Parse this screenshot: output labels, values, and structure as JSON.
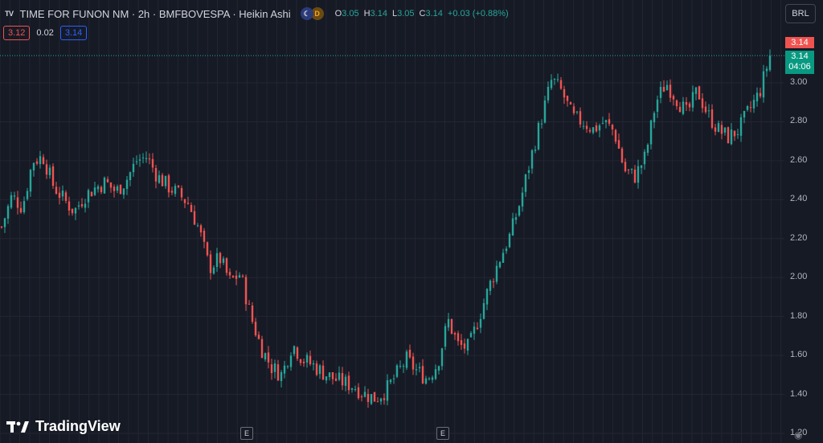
{
  "header": {
    "logo_glyph": "TV",
    "symbol_line": "TIME FOR FUNON NM · 2h · BMFBOVESPA · Heikin Ashi",
    "badge_d": "D",
    "ohlc": {
      "o_key": "O",
      "o_val": "3.05",
      "h_key": "H",
      "h_val": "3.14",
      "l_key": "L",
      "l_val": "3.05",
      "c_key": "C",
      "c_val": "3.14",
      "change": "+0.03 (+0.88%)"
    },
    "bid": "3.12",
    "spread": "0.02",
    "ask": "3.14"
  },
  "currency": "BRL",
  "price_tags": {
    "red": "3.14",
    "green": "3.14",
    "countdown": "04:06"
  },
  "brand": {
    "name": "TradingView"
  },
  "events": [
    "E",
    "E"
  ],
  "colors": {
    "background": "#161a25",
    "up": "#26a69a",
    "down": "#ef5350",
    "grid": "#232632",
    "price_line": "#26a69a"
  },
  "chart_data": {
    "type": "candlestick",
    "style": "Heikin Ashi",
    "interval": "2h",
    "grid": true,
    "y_ticks": [
      "3.00",
      "2.80",
      "2.60",
      "2.40",
      "2.20",
      "2.00",
      "1.80",
      "1.60",
      "1.40",
      "1.20"
    ],
    "ylim": [
      1.2,
      3.2
    ],
    "last_price": 3.14,
    "price_path": [
      2.26,
      2.42,
      2.36,
      2.6,
      2.62,
      2.47,
      2.4,
      2.34,
      2.42,
      2.46,
      2.49,
      2.44,
      2.5,
      2.6,
      2.62,
      2.52,
      2.47,
      2.43,
      2.38,
      2.25,
      2.05,
      2.1,
      1.98,
      2.02,
      1.8,
      1.64,
      1.54,
      1.5,
      1.66,
      1.58,
      1.55,
      1.51,
      1.48,
      1.46,
      1.44,
      1.4,
      1.38,
      1.42,
      1.5,
      1.58,
      1.52,
      1.48,
      1.56,
      1.78,
      1.65,
      1.64,
      1.8,
      1.96,
      2.1,
      2.22,
      2.4,
      2.62,
      2.82,
      3.02,
      2.95,
      2.82,
      2.8,
      2.76,
      2.8,
      2.75,
      2.55,
      2.52,
      2.62,
      2.9,
      3.0,
      2.92,
      2.84,
      2.96,
      2.84,
      2.76,
      2.72,
      2.76,
      2.86,
      2.95,
      3.14
    ]
  }
}
